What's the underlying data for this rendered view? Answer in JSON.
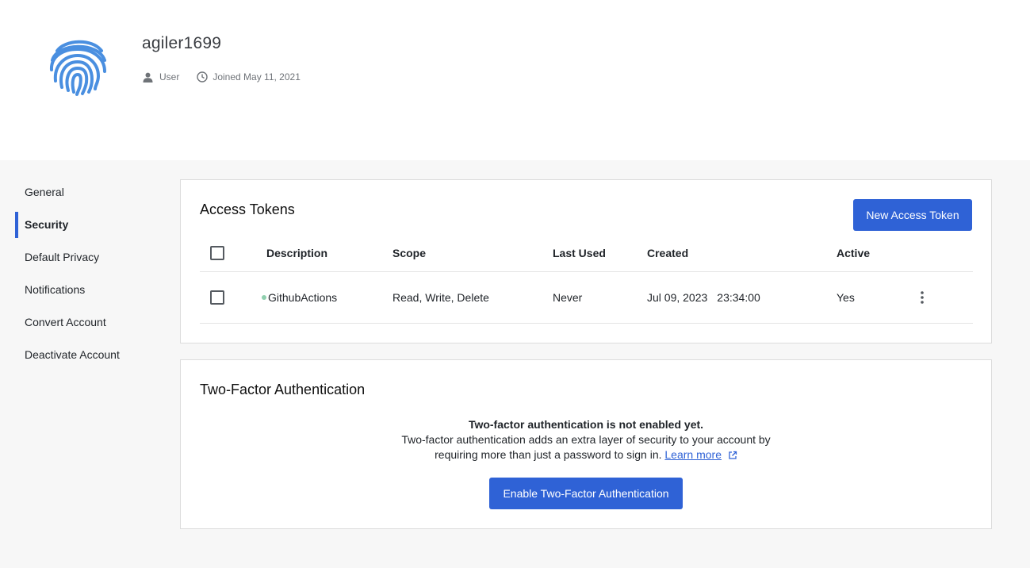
{
  "profile": {
    "username": "agiler1699",
    "role": "User",
    "joined": "Joined May 11, 2021",
    "avatar_icon": "fingerprint-icon",
    "avatar_color": "#4a8fe0"
  },
  "sidebar": {
    "items": [
      {
        "label": "General",
        "active": false
      },
      {
        "label": "Security",
        "active": true
      },
      {
        "label": "Default Privacy",
        "active": false
      },
      {
        "label": "Notifications",
        "active": false
      },
      {
        "label": "Convert Account",
        "active": false
      },
      {
        "label": "Deactivate Account",
        "active": false
      }
    ]
  },
  "tokens": {
    "title": "Access Tokens",
    "new_button": "New Access Token",
    "columns": {
      "description": "Description",
      "scope": "Scope",
      "last_used": "Last Used",
      "created": "Created",
      "active": "Active"
    },
    "rows": [
      {
        "description": "GithubActions",
        "scope": "Read, Write, Delete",
        "last_used": "Never",
        "created_date": "Jul 09, 2023",
        "created_time": "23:34:00",
        "active": "Yes",
        "status_color": "#8fcfae"
      }
    ]
  },
  "tfa": {
    "title": "Two-Factor Authentication",
    "status": "Two-factor authentication is not enabled yet.",
    "desc_line1": "Two-factor authentication adds an extra layer of security to your account by",
    "desc_line2": "requiring more than just a password to sign in.",
    "learn_more": "Learn more",
    "button": "Enable Two-Factor Authentication"
  },
  "colors": {
    "accent": "#2f62d6",
    "background": "#f7f7f7"
  }
}
